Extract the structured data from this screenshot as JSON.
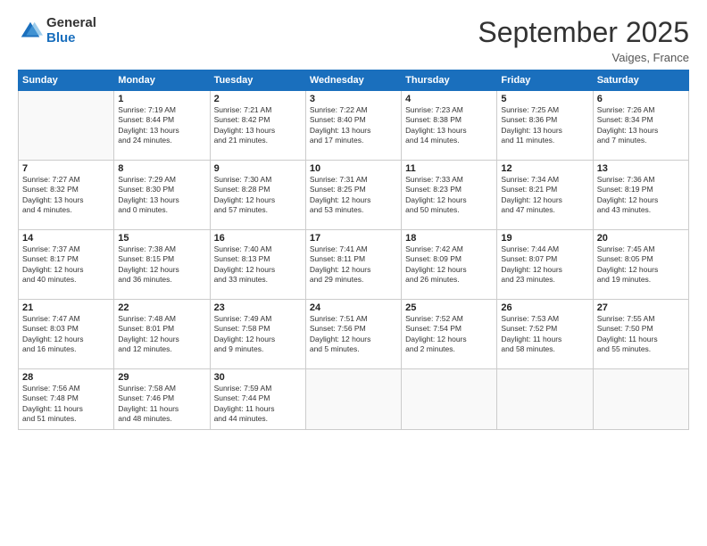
{
  "logo": {
    "general": "General",
    "blue": "Blue"
  },
  "header": {
    "title": "September 2025",
    "subtitle": "Vaiges, France"
  },
  "weekdays": [
    "Sunday",
    "Monday",
    "Tuesday",
    "Wednesday",
    "Thursday",
    "Friday",
    "Saturday"
  ],
  "weeks": [
    [
      {
        "day": "",
        "info": ""
      },
      {
        "day": "1",
        "info": "Sunrise: 7:19 AM\nSunset: 8:44 PM\nDaylight: 13 hours\nand 24 minutes."
      },
      {
        "day": "2",
        "info": "Sunrise: 7:21 AM\nSunset: 8:42 PM\nDaylight: 13 hours\nand 21 minutes."
      },
      {
        "day": "3",
        "info": "Sunrise: 7:22 AM\nSunset: 8:40 PM\nDaylight: 13 hours\nand 17 minutes."
      },
      {
        "day": "4",
        "info": "Sunrise: 7:23 AM\nSunset: 8:38 PM\nDaylight: 13 hours\nand 14 minutes."
      },
      {
        "day": "5",
        "info": "Sunrise: 7:25 AM\nSunset: 8:36 PM\nDaylight: 13 hours\nand 11 minutes."
      },
      {
        "day": "6",
        "info": "Sunrise: 7:26 AM\nSunset: 8:34 PM\nDaylight: 13 hours\nand 7 minutes."
      }
    ],
    [
      {
        "day": "7",
        "info": "Sunrise: 7:27 AM\nSunset: 8:32 PM\nDaylight: 13 hours\nand 4 minutes."
      },
      {
        "day": "8",
        "info": "Sunrise: 7:29 AM\nSunset: 8:30 PM\nDaylight: 13 hours\nand 0 minutes."
      },
      {
        "day": "9",
        "info": "Sunrise: 7:30 AM\nSunset: 8:28 PM\nDaylight: 12 hours\nand 57 minutes."
      },
      {
        "day": "10",
        "info": "Sunrise: 7:31 AM\nSunset: 8:25 PM\nDaylight: 12 hours\nand 53 minutes."
      },
      {
        "day": "11",
        "info": "Sunrise: 7:33 AM\nSunset: 8:23 PM\nDaylight: 12 hours\nand 50 minutes."
      },
      {
        "day": "12",
        "info": "Sunrise: 7:34 AM\nSunset: 8:21 PM\nDaylight: 12 hours\nand 47 minutes."
      },
      {
        "day": "13",
        "info": "Sunrise: 7:36 AM\nSunset: 8:19 PM\nDaylight: 12 hours\nand 43 minutes."
      }
    ],
    [
      {
        "day": "14",
        "info": "Sunrise: 7:37 AM\nSunset: 8:17 PM\nDaylight: 12 hours\nand 40 minutes."
      },
      {
        "day": "15",
        "info": "Sunrise: 7:38 AM\nSunset: 8:15 PM\nDaylight: 12 hours\nand 36 minutes."
      },
      {
        "day": "16",
        "info": "Sunrise: 7:40 AM\nSunset: 8:13 PM\nDaylight: 12 hours\nand 33 minutes."
      },
      {
        "day": "17",
        "info": "Sunrise: 7:41 AM\nSunset: 8:11 PM\nDaylight: 12 hours\nand 29 minutes."
      },
      {
        "day": "18",
        "info": "Sunrise: 7:42 AM\nSunset: 8:09 PM\nDaylight: 12 hours\nand 26 minutes."
      },
      {
        "day": "19",
        "info": "Sunrise: 7:44 AM\nSunset: 8:07 PM\nDaylight: 12 hours\nand 23 minutes."
      },
      {
        "day": "20",
        "info": "Sunrise: 7:45 AM\nSunset: 8:05 PM\nDaylight: 12 hours\nand 19 minutes."
      }
    ],
    [
      {
        "day": "21",
        "info": "Sunrise: 7:47 AM\nSunset: 8:03 PM\nDaylight: 12 hours\nand 16 minutes."
      },
      {
        "day": "22",
        "info": "Sunrise: 7:48 AM\nSunset: 8:01 PM\nDaylight: 12 hours\nand 12 minutes."
      },
      {
        "day": "23",
        "info": "Sunrise: 7:49 AM\nSunset: 7:58 PM\nDaylight: 12 hours\nand 9 minutes."
      },
      {
        "day": "24",
        "info": "Sunrise: 7:51 AM\nSunset: 7:56 PM\nDaylight: 12 hours\nand 5 minutes."
      },
      {
        "day": "25",
        "info": "Sunrise: 7:52 AM\nSunset: 7:54 PM\nDaylight: 12 hours\nand 2 minutes."
      },
      {
        "day": "26",
        "info": "Sunrise: 7:53 AM\nSunset: 7:52 PM\nDaylight: 11 hours\nand 58 minutes."
      },
      {
        "day": "27",
        "info": "Sunrise: 7:55 AM\nSunset: 7:50 PM\nDaylight: 11 hours\nand 55 minutes."
      }
    ],
    [
      {
        "day": "28",
        "info": "Sunrise: 7:56 AM\nSunset: 7:48 PM\nDaylight: 11 hours\nand 51 minutes."
      },
      {
        "day": "29",
        "info": "Sunrise: 7:58 AM\nSunset: 7:46 PM\nDaylight: 11 hours\nand 48 minutes."
      },
      {
        "day": "30",
        "info": "Sunrise: 7:59 AM\nSunset: 7:44 PM\nDaylight: 11 hours\nand 44 minutes."
      },
      {
        "day": "",
        "info": ""
      },
      {
        "day": "",
        "info": ""
      },
      {
        "day": "",
        "info": ""
      },
      {
        "day": "",
        "info": ""
      }
    ]
  ]
}
